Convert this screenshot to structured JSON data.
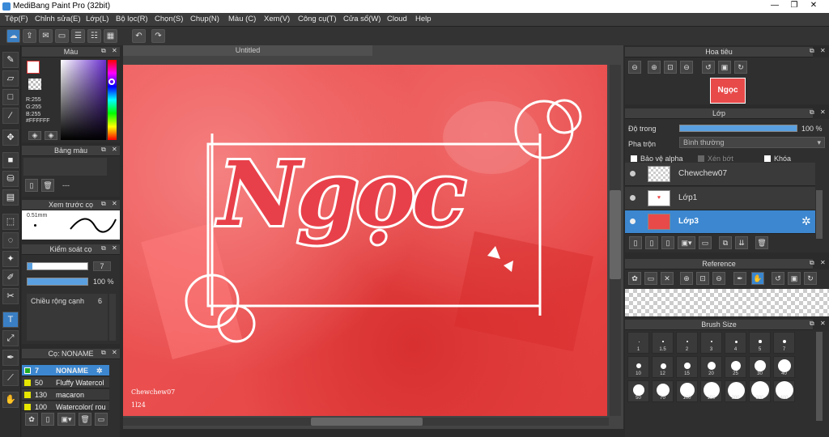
{
  "window": {
    "title": "MediBang Paint Pro (32bit)"
  },
  "menu": [
    "Tệp(F)",
    "Chỉnh sửa(E)",
    "Lớp(L)",
    "Bộ lọc(R)",
    "Chọn(S)",
    "Chụp(N)",
    "Màu (C)",
    "Xem(V)",
    "Công cụ(T)",
    "Cửa sổ(W)",
    "Cloud",
    "Help"
  ],
  "color_panel": {
    "title": "Màu",
    "r": "R:255",
    "g": "G:255",
    "b": "B:255",
    "hex": "#FFFFFF"
  },
  "palette_panel": {
    "title": "Bảng màu",
    "dash": "---"
  },
  "brush_preview": {
    "title": "Xem trước cọ",
    "size": "0.51mm"
  },
  "brush_control": {
    "title": "Kiểm soát cọ",
    "size": "7",
    "opacity": "100 %",
    "width_label": "Chiều rộng cạnh",
    "width_value": "6"
  },
  "brush_list": {
    "title": "Cọ: NONAME",
    "items": [
      {
        "size": "7",
        "name": "NONAME",
        "color": "#22aa22"
      },
      {
        "size": "50",
        "name": "Fluffy Watercol",
        "color": "#e6e600"
      },
      {
        "size": "130",
        "name": "macaron",
        "color": "#e6e600"
      },
      {
        "size": "100",
        "name": "Watercolor( rou",
        "color": "#e6e600"
      }
    ]
  },
  "canvas": {
    "tab": "Untitled",
    "art_title": "Ngọc",
    "signature": "Chewchew07",
    "sig2": "1l24"
  },
  "navigator": {
    "title": "Hoa tiêu",
    "thumb_text": "Ngọc"
  },
  "layer_panel": {
    "title": "Lớp",
    "opacity_label": "Độ trong",
    "opacity_value": "100 %",
    "blend_label": "Pha trộn",
    "blend_value": "Bình thường",
    "protect_alpha": "Bảo vệ alpha",
    "clipping": "Xén bớt",
    "lock": "Khóa",
    "layers": [
      {
        "name": "Chewchew07"
      },
      {
        "name": "Lớp1"
      },
      {
        "name": "Lớp3"
      }
    ]
  },
  "reference": {
    "title": "Reference"
  },
  "brush_size": {
    "title": "Brush Size",
    "sizes": [
      "1",
      "1.5",
      "2",
      "3",
      "4",
      "5",
      "7",
      "10",
      "12",
      "15",
      "20",
      "25",
      "30",
      "40",
      "50",
      "70",
      "100",
      "150",
      "200",
      "300",
      "400"
    ]
  }
}
